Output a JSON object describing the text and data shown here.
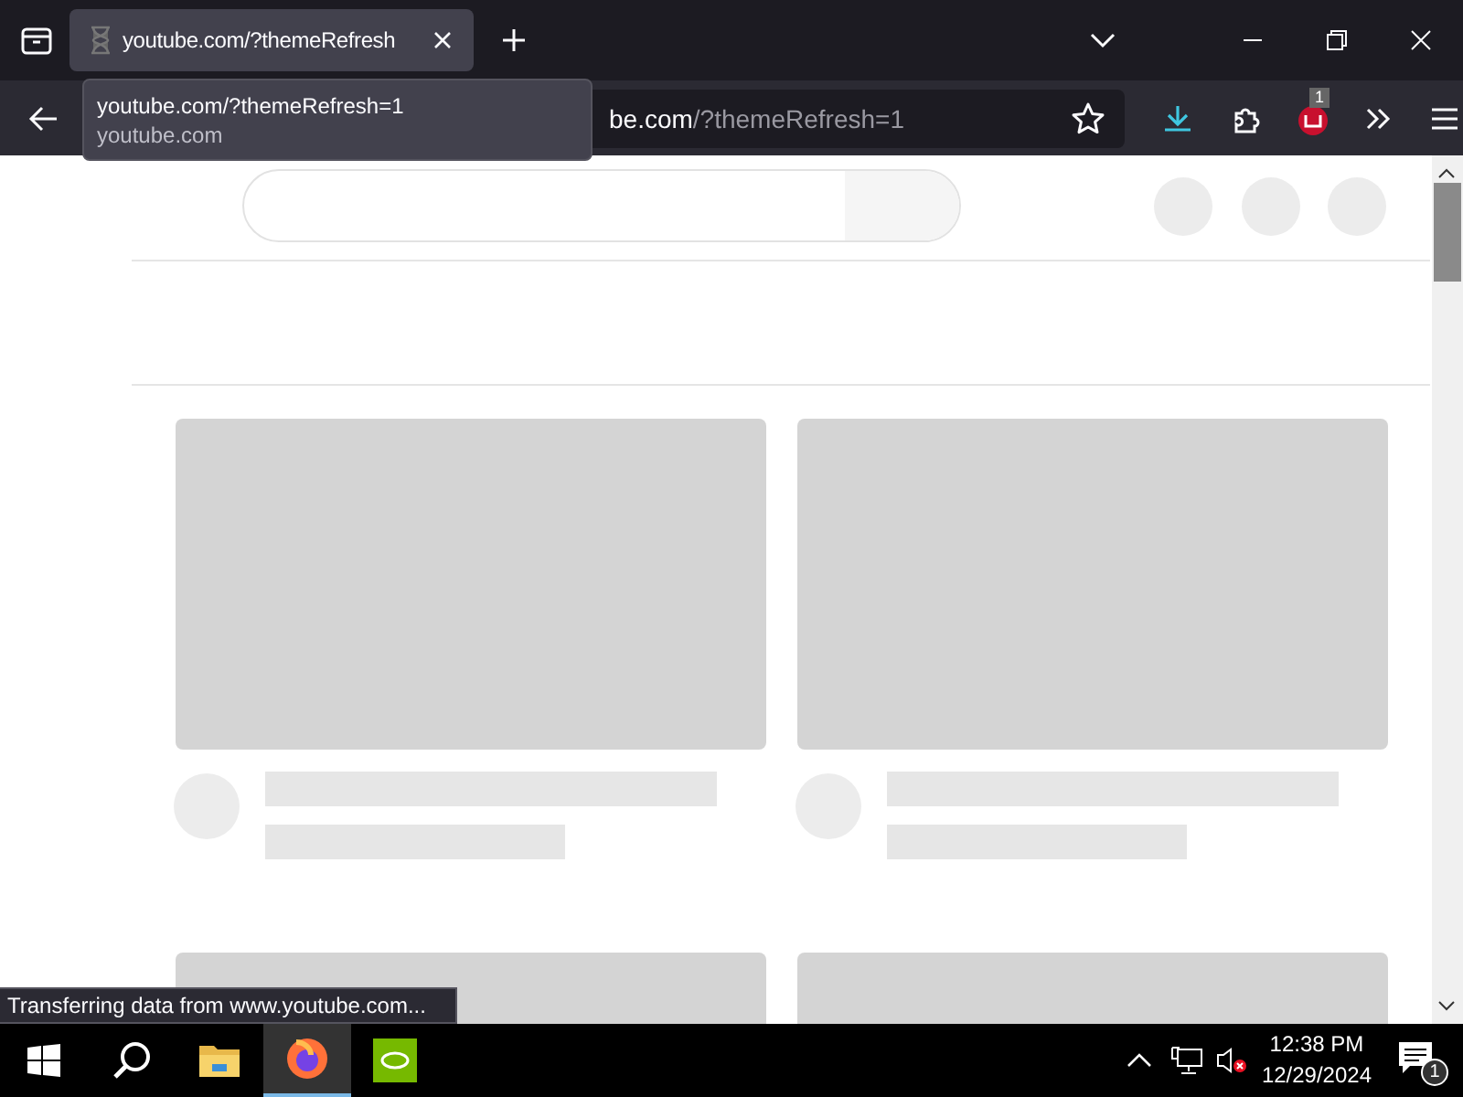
{
  "tabs": [
    {
      "title": "youtube.com/?themeRefresh",
      "selected": true
    }
  ],
  "tooltip": {
    "url": "youtube.com/?themeRefresh=1",
    "host": "youtube.com"
  },
  "address_bar": {
    "host_part": "be.com",
    "path_part": "/?themeRefresh=1"
  },
  "extension_badge": "1",
  "status_text": "Transferring data from www.youtube.com...",
  "taskbar": {
    "time": "12:38 PM",
    "date": "12/29/2024",
    "notification_count": "1"
  }
}
